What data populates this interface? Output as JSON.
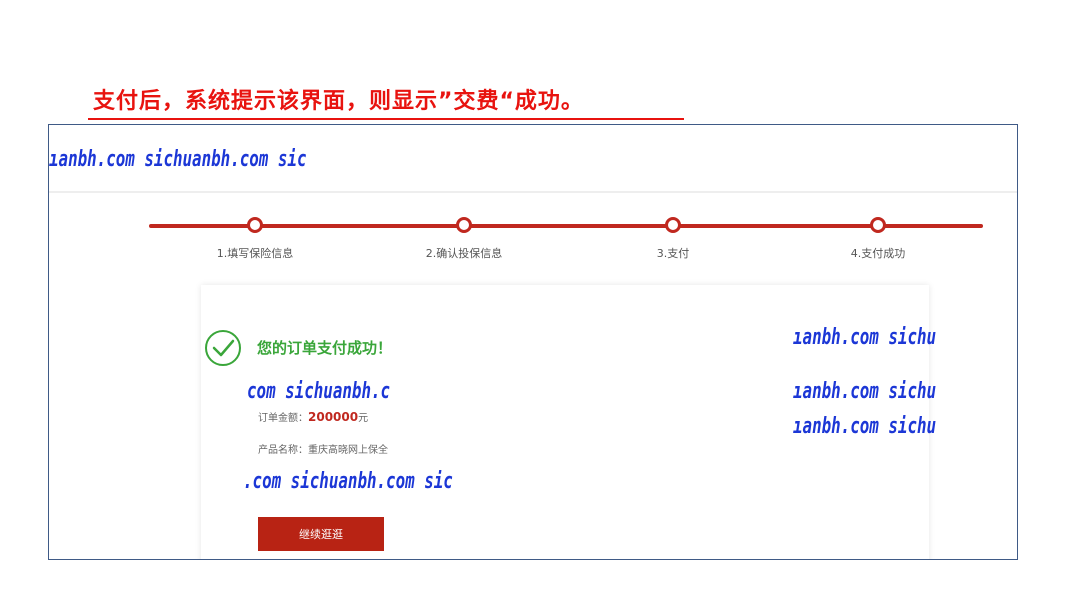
{
  "caption": "支付后，系统提示该界面，则显示”交费“成功。",
  "watermarks": {
    "top": "ıanbh.com   sichuanbh.com   sic",
    "right1": "ıanbh.com   sichu",
    "right2": "ıanbh.com   sichu",
    "right3": "ıanbh.com   sichu",
    "left1": "com   sichuanbh.c",
    "left2": ".com   sichuanbh.com   sic"
  },
  "steps": [
    {
      "label": "1.填写保险信息"
    },
    {
      "label": "2.确认投保信息"
    },
    {
      "label": "3.支付"
    },
    {
      "label": "4.支付成功"
    }
  ],
  "result": {
    "message": "您的订单支付成功！",
    "amount_label": "订单金额：",
    "amount_value": "200000",
    "amount_unit": "元",
    "product_label": "产品名称：",
    "product_value": "重庆高晓网上保全",
    "continue_label": "继续逛逛"
  },
  "colors": {
    "caption": "#e8130f",
    "accent": "#c0281f",
    "success": "#3aa63a",
    "watermark": "#1c37d6"
  },
  "icons": {
    "success": "check-circle-icon",
    "step": "step-node-icon"
  }
}
